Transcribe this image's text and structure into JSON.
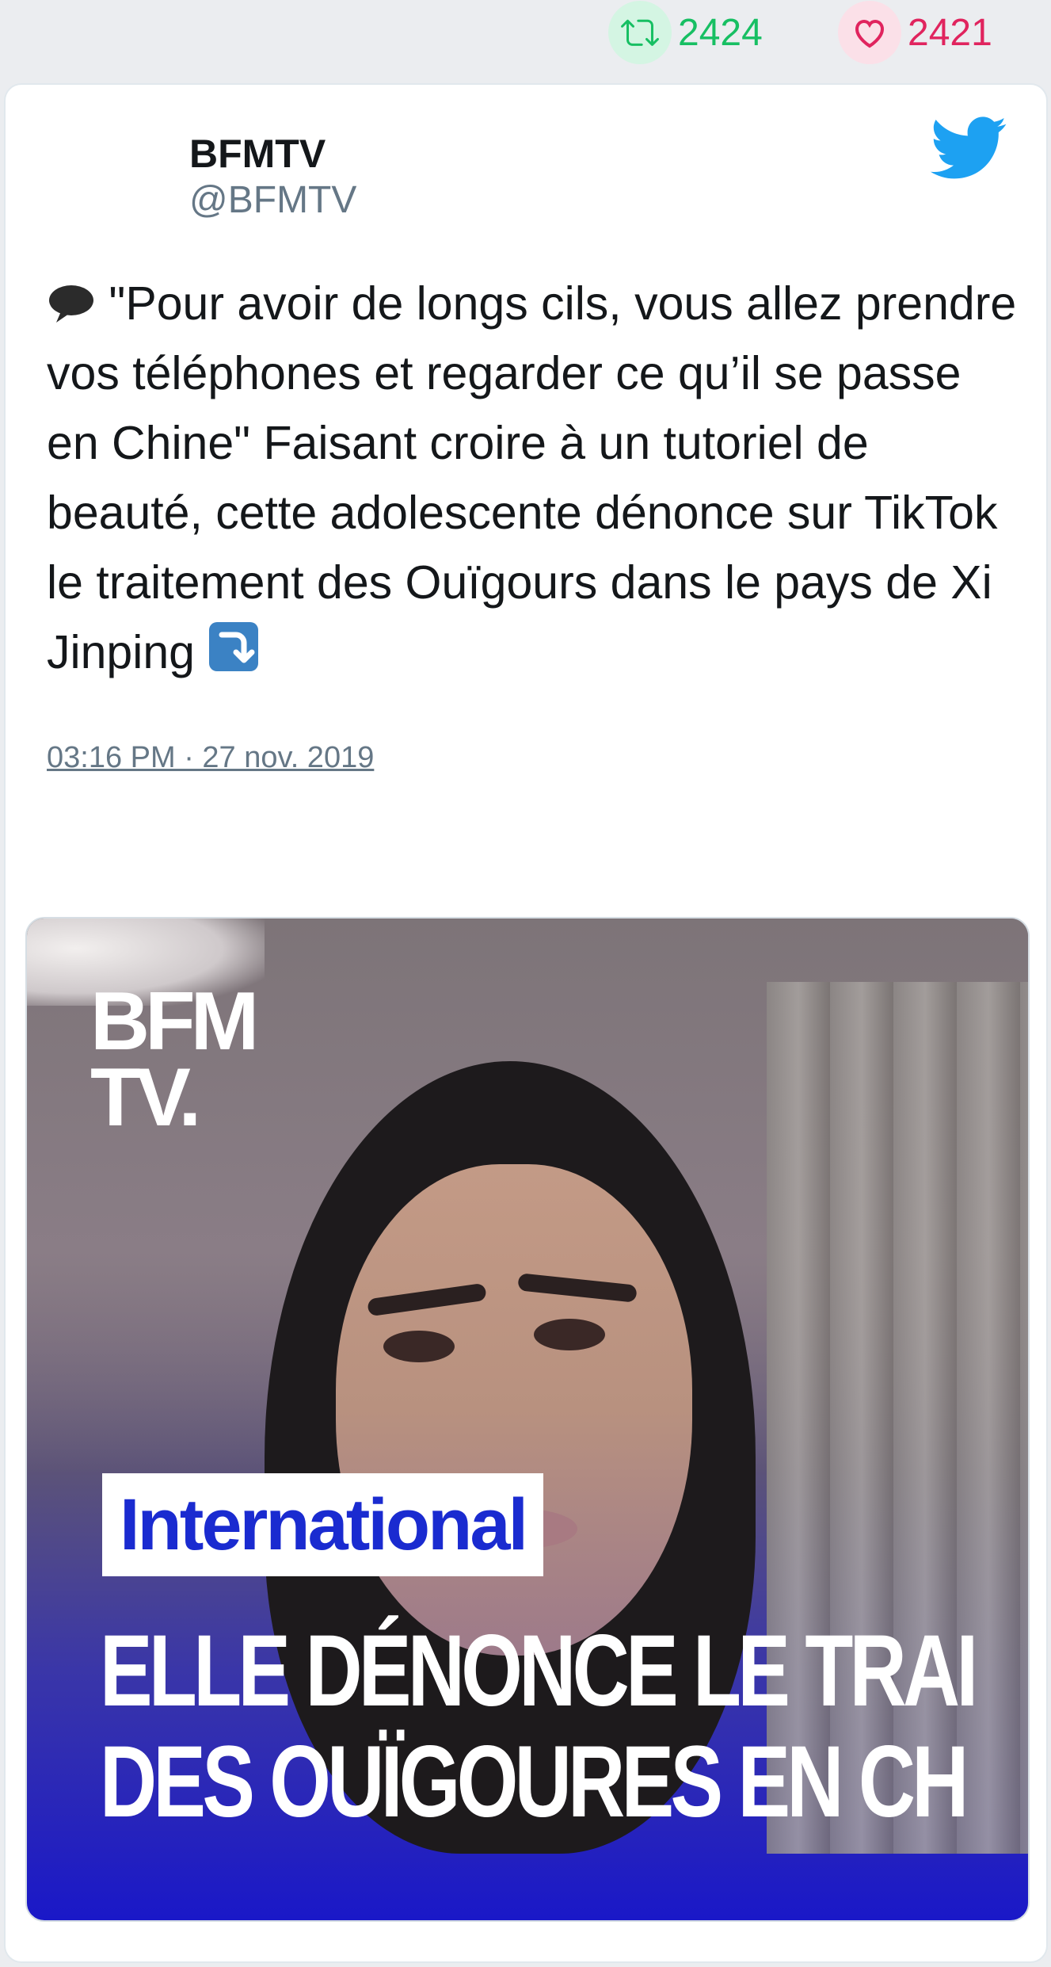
{
  "stats": {
    "retweets": "2424",
    "likes": "2421",
    "retweet_color": "#17bf63",
    "like_color": "#e0245e"
  },
  "tweet": {
    "author_name": "BFMTV",
    "author_handle": "@BFMTV",
    "text_before": " \"Pour avoir de longs cils, vous allez prendre vos téléphones et regarder ce qu’il se passe en Chine\" Faisant croire à un tutoriel de beauté, cette adolescente dénonce sur TikTok le traitement des Ouïgours dans le pays de Xi Jinping ",
    "timestamp": "03:16 PM · 27 nov. 2019",
    "lead_emoji": "speech-balloon-icon",
    "trailing_emoji": "arrow-down-right-icon"
  },
  "media": {
    "logo_line1": "BFM",
    "logo_line2": "TV.",
    "tag": "International",
    "headline_line1": "ELLE DÉNONCE LE TRAI",
    "headline_line2": "DES OUÏGOURES EN CH"
  },
  "icons": {
    "brand": "twitter-bird-icon",
    "reply": "reply-icon",
    "retweet": "retweet-icon",
    "like": "heart-icon",
    "brand_color": "#1da1f2"
  }
}
